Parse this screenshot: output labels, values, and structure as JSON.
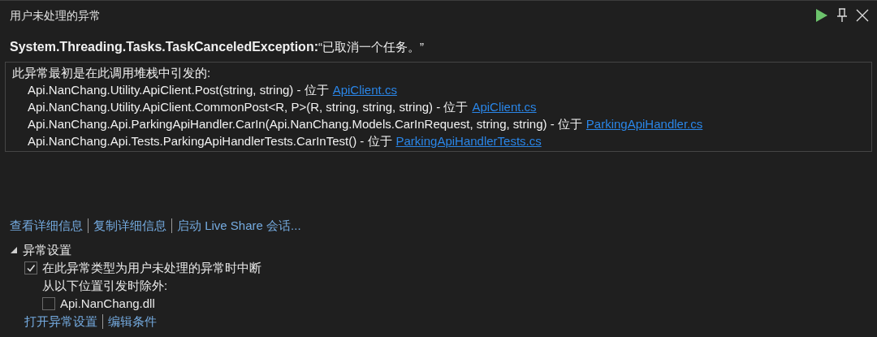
{
  "window": {
    "title": "用户未处理的异常"
  },
  "exception": {
    "type": "System.Threading.Tasks.TaskCanceledException:",
    "message": "“已取消一个任务。”"
  },
  "stack": {
    "heading": "此异常最初是在此调用堆栈中引发的:",
    "frames": [
      {
        "method": "Api.NanChang.Utility.ApiClient.Post(string, string) - 位于",
        "file": "ApiClient.cs"
      },
      {
        "method": "Api.NanChang.Utility.ApiClient.CommonPost<R, P>(R, string, string, string) - 位于",
        "file": "ApiClient.cs"
      },
      {
        "method": "Api.NanChang.Api.ParkingApiHandler.CarIn(Api.NanChang.Models.CarInRequest, string, string) - 位于",
        "file": "ParkingApiHandler.cs"
      },
      {
        "method": "Api.NanChang.Api.Tests.ParkingApiHandlerTests.CarInTest() - 位于",
        "file": "ParkingApiHandlerTests.cs"
      }
    ]
  },
  "links": [
    "查看详细信息",
    "复制详细信息",
    "启动 Live Share 会话..."
  ],
  "settings": {
    "title": "异常设置",
    "expanded": true,
    "break_when": {
      "label": "在此异常类型为用户未处理的异常时中断",
      "checked": true
    },
    "except_label": "从以下位置引发时除外:",
    "modules": [
      {
        "label": "Api.NanChang.dll",
        "checked": false
      }
    ],
    "links": [
      "打开异常设置",
      "编辑条件"
    ]
  }
}
